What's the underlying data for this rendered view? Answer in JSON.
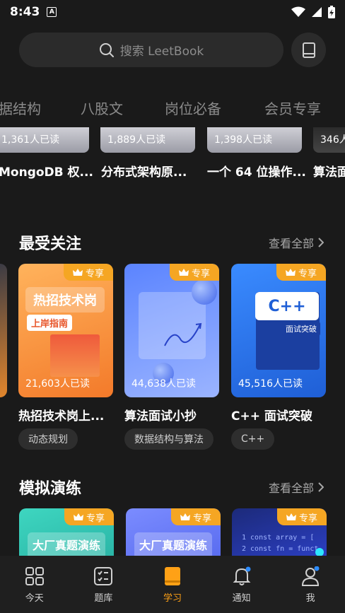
{
  "status": {
    "time": "8:43",
    "a_icon": "A"
  },
  "search": {
    "placeholder": "搜索 LeetBook"
  },
  "categories": [
    "据结构",
    "八股文",
    "岗位必备",
    "会员专享"
  ],
  "top_strip": [
    {
      "readers": "1,361人已读",
      "title": "MongoDB 权..."
    },
    {
      "readers": "1,889人已读",
      "title": "分布式架构原..."
    },
    {
      "readers": "1,398人已读",
      "title": "一个 64 位操作..."
    },
    {
      "readers": "346人",
      "title": "算法面"
    }
  ],
  "popular": {
    "title": "最受关注",
    "see_all": "查看全部",
    "books": [
      {
        "badge": "专享",
        "readers": "21,603人已读",
        "title": "热招技术岗上...",
        "tag": "动态规划",
        "cover_line1": "热招技术岗",
        "cover_line2": "上岸指南"
      },
      {
        "badge": "专享",
        "readers": "44,638人已读",
        "title": "算法面试小抄",
        "tag": "数据结构与算法"
      },
      {
        "badge": "专享",
        "readers": "45,516人已读",
        "title": "C++ 面试突破",
        "tag": "C++",
        "cover_line1": "C++",
        "cover_line2": "面试突破"
      }
    ]
  },
  "practice": {
    "title": "模拟演练",
    "see_all": "查看全部",
    "books": [
      {
        "badge": "专享",
        "cover_line1": "大厂真题演练"
      },
      {
        "badge": "专享",
        "cover_line1": "大厂真题演练"
      },
      {
        "badge": "专享",
        "cover_line1": "1  const array = [",
        "cover_line2": "2  const fn = funct"
      }
    ]
  },
  "nav": [
    {
      "label": "今天",
      "icon": "grid-icon"
    },
    {
      "label": "题库",
      "icon": "checklist-icon"
    },
    {
      "label": "学习",
      "icon": "book-icon",
      "active": true
    },
    {
      "label": "通知",
      "icon": "bell-icon"
    },
    {
      "label": "我",
      "icon": "user-icon"
    }
  ],
  "colors": {
    "accent": "#ffa116",
    "vip": "#f5a623",
    "background": "#1a1a1a"
  }
}
